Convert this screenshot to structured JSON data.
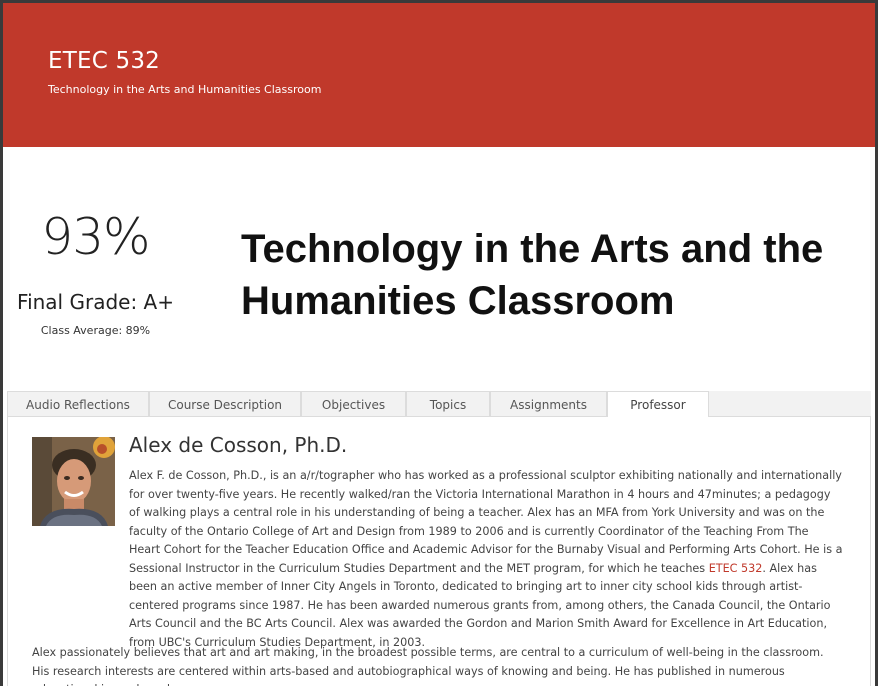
{
  "site": {
    "title": "ETEC 532",
    "tagline": "Technology in the Arts and Humanities Classroom"
  },
  "grade": {
    "percent": "93%",
    "final": "Final Grade: A+",
    "class_average": "Class Average: 89%"
  },
  "course_heading": "Technology in the Arts and the Humanities Classroom",
  "tabs": [
    {
      "label": "Audio Reflections",
      "active": false
    },
    {
      "label": "Course Description",
      "active": false
    },
    {
      "label": "Objectives",
      "active": false
    },
    {
      "label": "Topics",
      "active": false
    },
    {
      "label": "Assignments",
      "active": false
    },
    {
      "label": "Professor",
      "active": true
    }
  ],
  "professor": {
    "name": "Alex de Cosson, Ph.D.",
    "bio_part1": "Alex F. de Cosson, Ph.D., is an a/r/tographer who has worked as a professional sculptor exhibiting nationally and internationally for over twenty-five years. He recently walked/ran the Victoria International Marathon in 4 hours and 47minutes; a pedagogy of walking plays a central role in his understanding of being a teacher. Alex has an MFA from York University and was on the faculty of the Ontario College of Art and Design from 1989 to 2006 and is currently Coordinator of the Teaching From The Heart Cohort for the Teacher Education Office and Academic Advisor for the Burnaby Visual and Performing Arts Cohort. He is a Sessional Instructor in the Curriculum Studies Department and the MET program, for which he teaches ",
    "bio_link": "ETEC 532",
    "bio_part2": ". Alex has been an active member of Inner City Angels in Toronto, dedicated to bringing art to inner city school kids through artist-centered programs since 1987. He has been awarded numerous grants from, among others, the Canada Council, the Ontario Arts Council and the BC Arts Council. Alex was awarded the Gordon and Marion Smith Award for Excellence in Art Education, from UBC's Curriculum Studies Department, in 2003.",
    "bio_para2": "Alex passionately believes that art and art making, in the broadest possible terms, are central to a curriculum of well-being in the classroom. His research interests are centered within arts-based and autobiographical ways of knowing and being. He has published in numerous educational journals and"
  },
  "colors": {
    "header_bg": "#c0392b",
    "link": "#c0392b"
  }
}
